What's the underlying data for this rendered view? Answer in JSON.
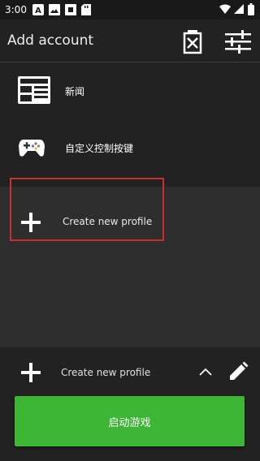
{
  "status_bar": {
    "time": "3:00",
    "icons": [
      "a-icon",
      "image-icon",
      "stop-icon",
      "sd-icon",
      "wifi-icon",
      "signal-icon",
      "battery-icon"
    ]
  },
  "toolbar": {
    "title": "Add account",
    "delete_icon": "delete-account-icon",
    "settings_icon": "sliders-icon"
  },
  "menu": {
    "items": [
      {
        "label": "新闻",
        "icon": "news-icon"
      },
      {
        "label": "自定义控制按键",
        "icon": "gamepad-icon"
      }
    ]
  },
  "profile": {
    "create_label": "Create new profile",
    "icon": "plus-icon"
  },
  "bottom": {
    "profile_label": "Create new profile",
    "expand_icon": "chevron-up-icon",
    "edit_icon": "pencil-icon",
    "launch_label": "启动游戏"
  },
  "colors": {
    "background": "#222222",
    "panel": "#2e2e2e",
    "accent_green": "#3cb634",
    "highlight_red": "#c83030"
  }
}
